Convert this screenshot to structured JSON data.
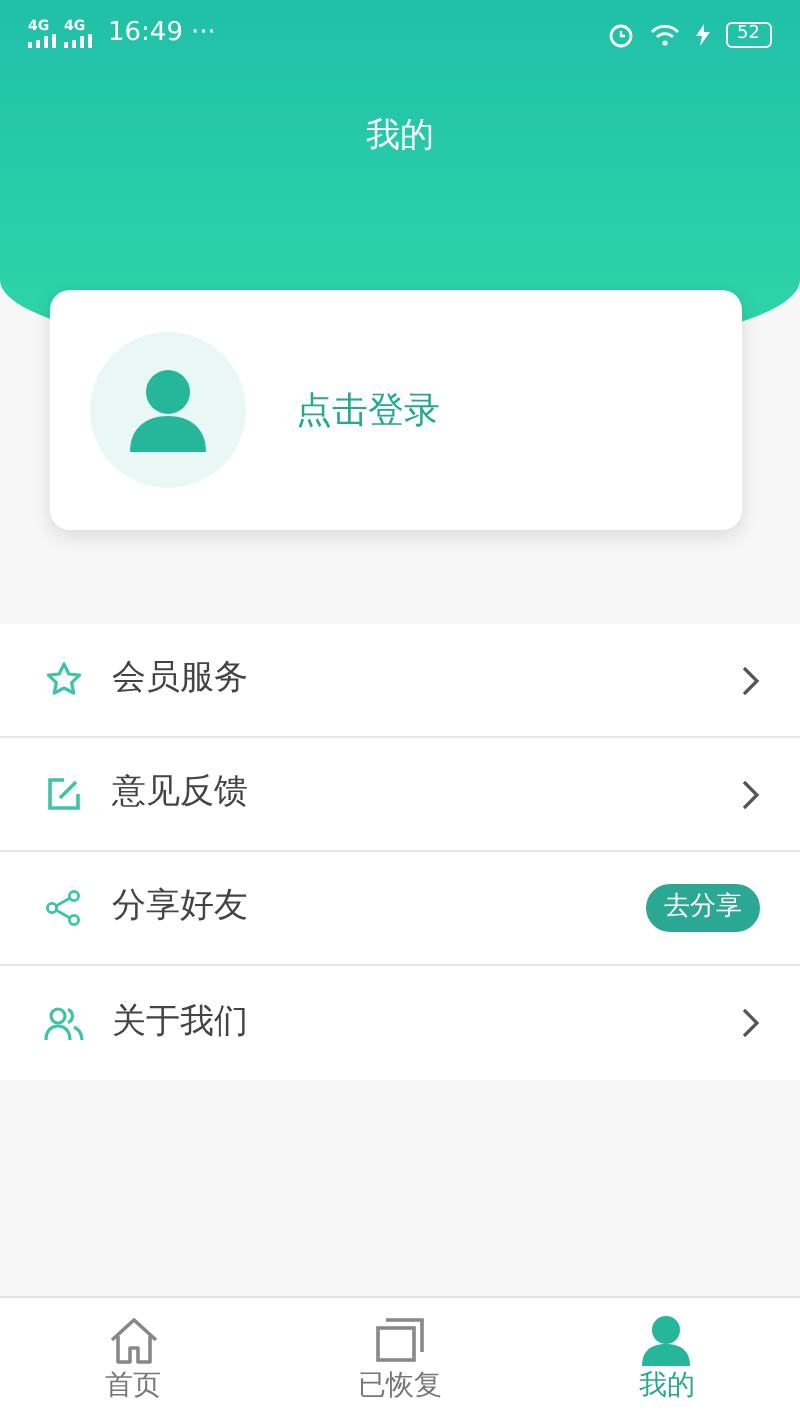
{
  "status_bar": {
    "networks": [
      "4G",
      "4G"
    ],
    "time": "16:49",
    "more": "···",
    "battery": "52"
  },
  "header": {
    "title": "我的"
  },
  "profile": {
    "login_text": "点击登录"
  },
  "menu": [
    {
      "label": "会员服务",
      "kind": "arrow"
    },
    {
      "label": "意见反馈",
      "kind": "arrow"
    },
    {
      "label": "分享好友",
      "kind": "action",
      "action": "去分享"
    },
    {
      "label": "关于我们",
      "kind": "arrow"
    }
  ],
  "tabs": [
    {
      "label": "首页",
      "selected": false
    },
    {
      "label": "已恢复",
      "selected": false
    },
    {
      "label": "我的",
      "selected": true
    }
  ]
}
